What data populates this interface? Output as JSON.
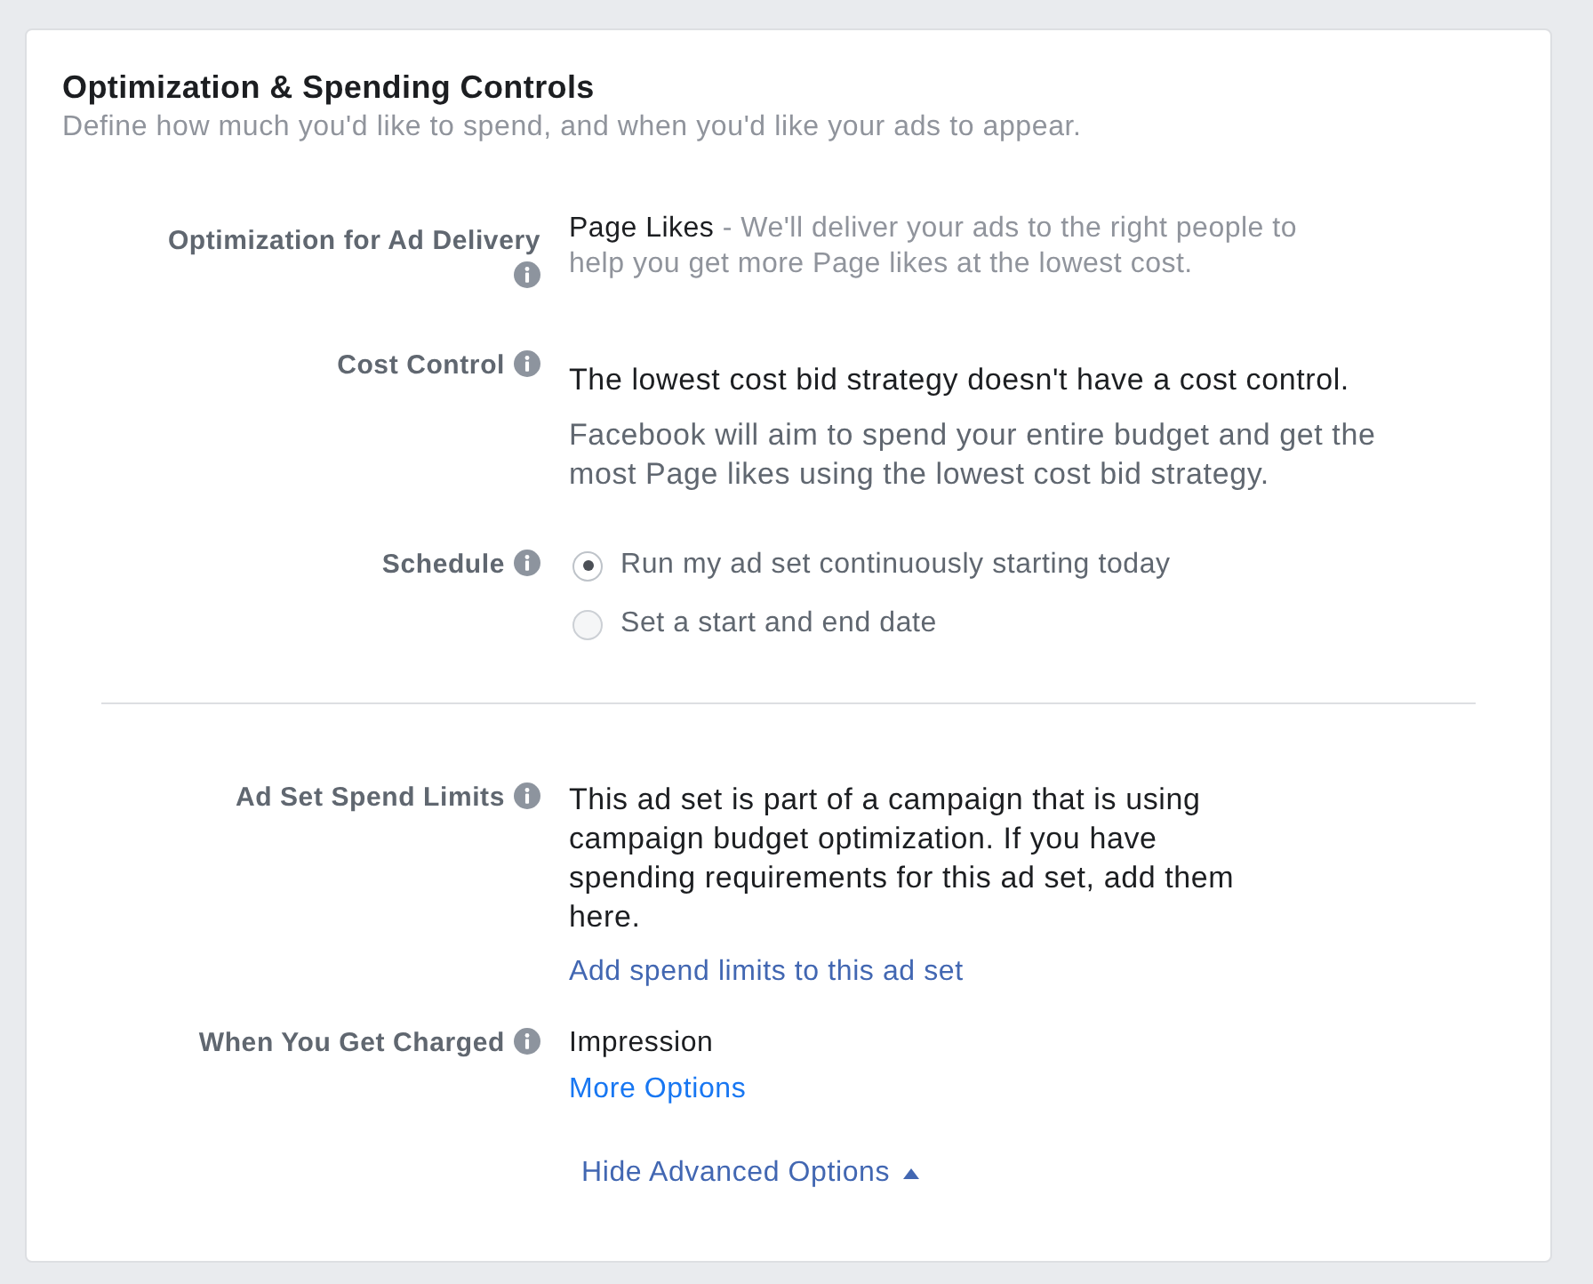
{
  "panel": {
    "title": "Optimization & Spending Controls",
    "subtitle": "Define how much you'd like to spend, and when you'd like your ads to appear."
  },
  "sections": [
    {
      "rows": [
        {
          "label": "Optimization for Ad Delivery",
          "info": true,
          "content": [
            {
              "kind": "summary",
              "value": "Page Likes",
              "description": "- We'll deliver your ads to the right people to help you get more Page likes at the lowest cost."
            }
          ]
        },
        {
          "label": "Cost Control",
          "info": true,
          "content": [
            {
              "kind": "statement",
              "text": "The lowest cost bid strategy doesn't have a cost control."
            },
            {
              "kind": "note",
              "text": "Facebook will aim to spend your entire budget and get the most Page likes using the lowest cost bid strategy."
            }
          ]
        },
        {
          "label": "Schedule",
          "info": true,
          "content": [
            {
              "kind": "radios",
              "options": [
                {
                  "label": "Run my ad set continuously starting today",
                  "selected": true
                },
                {
                  "label": "Set a start and end date",
                  "selected": false
                }
              ]
            }
          ]
        }
      ]
    },
    {
      "rows": [
        {
          "label": "Ad Set Spend Limits",
          "info": true,
          "content": [
            {
              "kind": "text",
              "text": "This ad set is part of a campaign that is using campaign budget optimization. If you have spending requirements for this ad set, add them here."
            },
            {
              "kind": "link",
              "text": "Add spend limits to this ad set"
            }
          ]
        },
        {
          "label": "When You Get Charged",
          "info": true,
          "content": [
            {
              "kind": "value",
              "text": "Impression"
            },
            {
              "kind": "option_link",
              "text": "More Options"
            }
          ]
        }
      ]
    }
  ],
  "toggle": {
    "label": "Hide Advanced Options",
    "expanded": true
  }
}
